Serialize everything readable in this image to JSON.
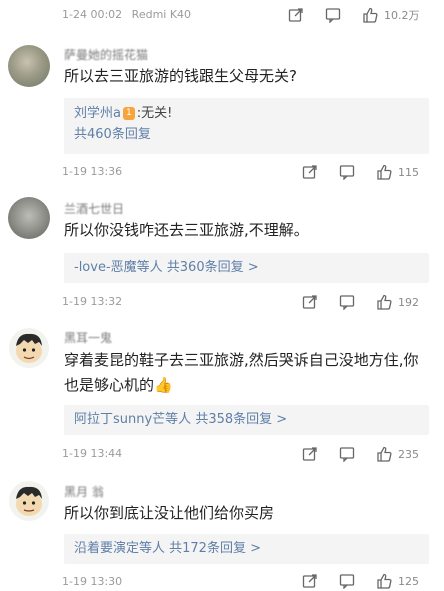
{
  "top_bar": {
    "date": "1-24 00:02",
    "device": "Redmi K40",
    "like_count": "10.2万"
  },
  "comments": [
    {
      "username": "萨曼她的摇花猫",
      "text": "所以去三亚旅游的钱跟生父母无关?",
      "reply_preview": {
        "author": "刘学州a",
        "badge": "1",
        "text": ":无关!"
      },
      "reply_count_label": "共460条回复",
      "date": "1-19 13:36",
      "like_count": "115"
    },
    {
      "username": "兰酒七世日",
      "text": "所以你没钱咋还去三亚旅游,不理解。",
      "reply_summary": "-love-恶魔等人 共360条回复 >",
      "date": "1-19 13:32",
      "like_count": "192"
    },
    {
      "username": "黑耳一鬼",
      "text": "穿着麦昆的鞋子去三亚旅游,然后哭诉自己没地方住,你也是够心机的👍",
      "reply_summary": "阿拉丁sunny芒等人 共358条回复 >",
      "date": "1-19 13:44",
      "like_count": "235"
    },
    {
      "username": "黑月 翁",
      "text": "所以你到底让没让他们给你买房",
      "reply_summary": "沿着要演定等人 共172条回复 >",
      "date": "1-19 13:30",
      "like_count": "125"
    }
  ],
  "icons": {
    "share": "share-icon",
    "comment": "comment-icon",
    "like": "thumbs-up-icon"
  }
}
